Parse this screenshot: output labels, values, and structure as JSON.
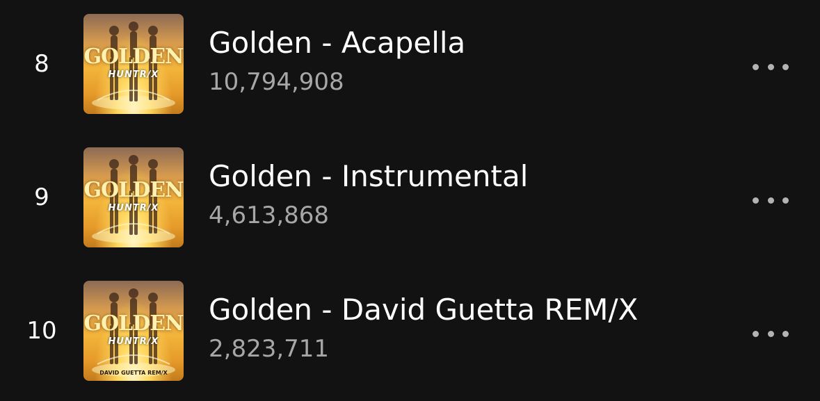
{
  "tracks": [
    {
      "rank": "8",
      "title": "Golden - Acapella",
      "plays": "10,794,908",
      "cover": {
        "title": "GOLDEN",
        "brand": "HUNTR/X",
        "subtitle": ""
      }
    },
    {
      "rank": "9",
      "title": "Golden - Instrumental",
      "plays": "4,613,868",
      "cover": {
        "title": "GOLDEN",
        "brand": "HUNTR/X",
        "subtitle": ""
      }
    },
    {
      "rank": "10",
      "title": "Golden - David Guetta REM/X",
      "plays": "2,823,711",
      "cover": {
        "title": "GOLDEN",
        "brand": "HUNTR/X",
        "subtitle": "DAVID GUETTA REM/X"
      }
    }
  ],
  "icons": {
    "more": "more-horizontal-icon"
  },
  "colors": {
    "background": "#121212",
    "primary_text": "#ffffff",
    "secondary_text": "#a7a7a7",
    "cover_accent": "#f2b43a"
  }
}
